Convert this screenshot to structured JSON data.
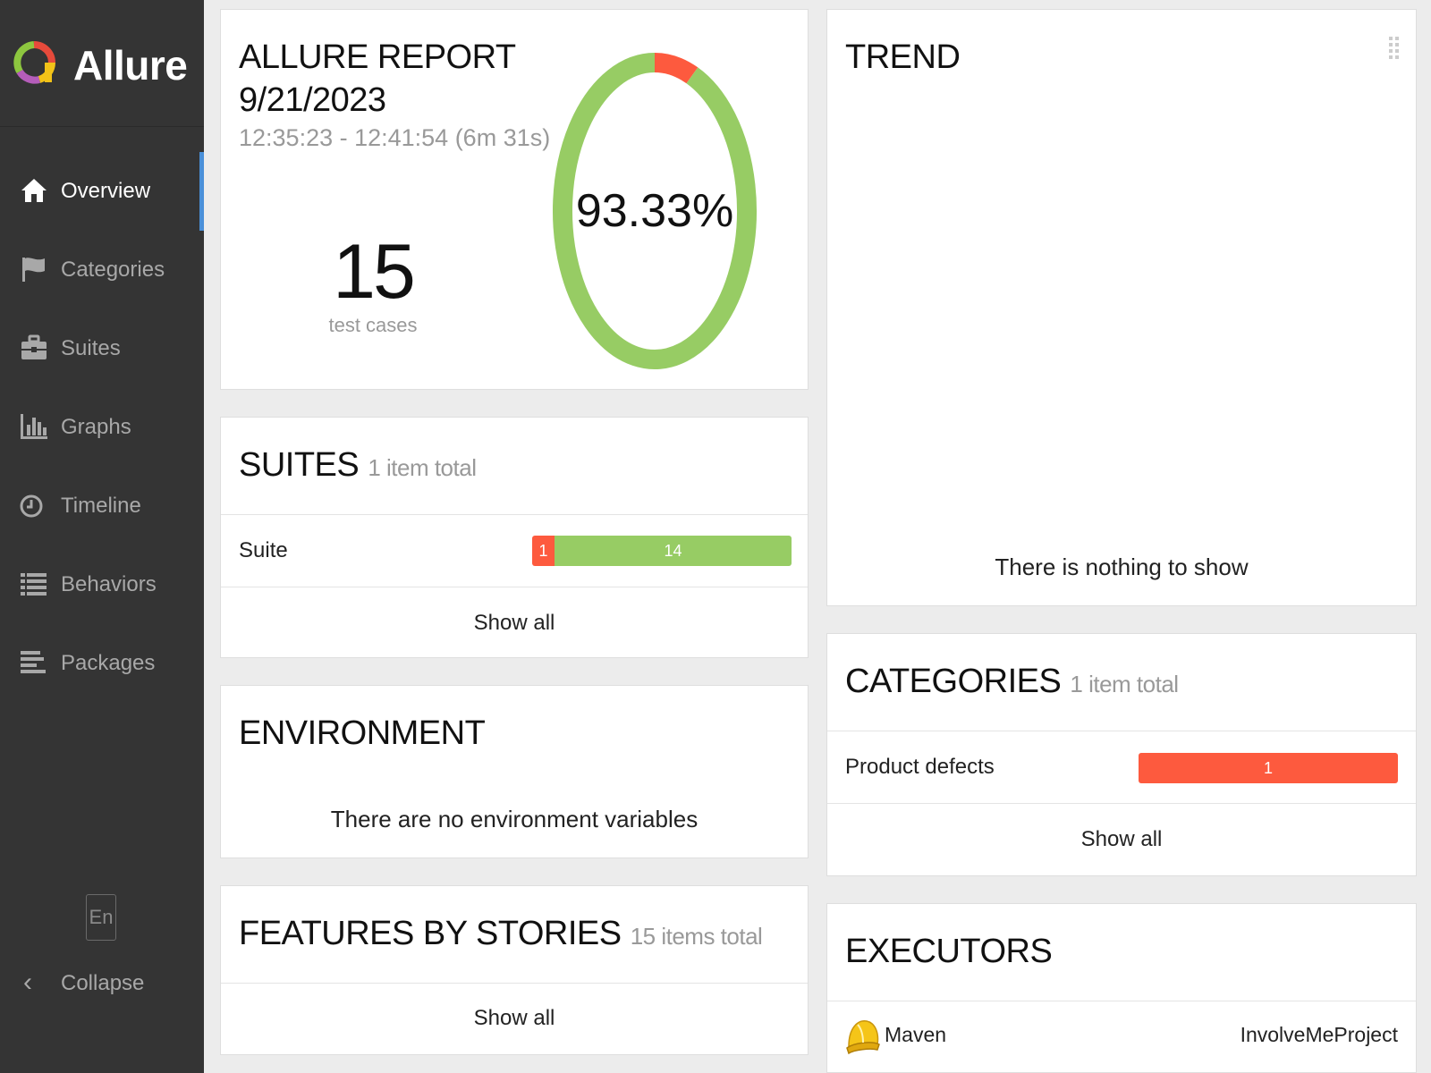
{
  "app": {
    "name": "Allure"
  },
  "sidebar": {
    "items": [
      {
        "label": "Overview",
        "icon": "home-icon",
        "active": true
      },
      {
        "label": "Categories",
        "icon": "flag-icon"
      },
      {
        "label": "Suites",
        "icon": "briefcase-icon"
      },
      {
        "label": "Graphs",
        "icon": "bar-chart-icon"
      },
      {
        "label": "Timeline",
        "icon": "clock-icon"
      },
      {
        "label": "Behaviors",
        "icon": "list-icon"
      },
      {
        "label": "Packages",
        "icon": "align-left-icon"
      }
    ],
    "language": "En",
    "collapse_label": "Collapse"
  },
  "report": {
    "title": "ALLURE REPORT",
    "date": "9/21/2023",
    "time_range": "12:35:23 - 12:41:54 (6m 31s)",
    "test_count": "15",
    "test_count_label": "test cases",
    "success_rate": "93.33%"
  },
  "chart_data": {
    "type": "pie",
    "categories": [
      "failed",
      "passed"
    ],
    "values": [
      1,
      14
    ],
    "colors": [
      "#fd5a3e",
      "#97cc64"
    ]
  },
  "suites": {
    "title": "SUITES",
    "subtitle": "1 item total",
    "rows": [
      {
        "name": "Suite",
        "failed": "1",
        "passed": "14"
      }
    ],
    "show_all": "Show all"
  },
  "environment": {
    "title": "ENVIRONMENT",
    "empty_message": "There are no environment variables"
  },
  "features": {
    "title": "FEATURES BY STORIES",
    "subtitle": "15 items total",
    "show_all": "Show all"
  },
  "trend": {
    "title": "TREND",
    "empty_message": "There is nothing to show"
  },
  "categories": {
    "title": "CATEGORIES",
    "subtitle": "1 item total",
    "rows": [
      {
        "name": "Product defects",
        "count": "1"
      }
    ],
    "show_all": "Show all"
  },
  "executors": {
    "title": "EXECUTORS",
    "items": [
      {
        "name": "Maven",
        "project": "InvolveMeProject",
        "icon": "maven-helmet-icon"
      }
    ]
  },
  "colors": {
    "sidebar_bg": "#343434",
    "active_accent": "#4a90d9",
    "passed": "#97cc64",
    "failed": "#fd5a3e"
  }
}
